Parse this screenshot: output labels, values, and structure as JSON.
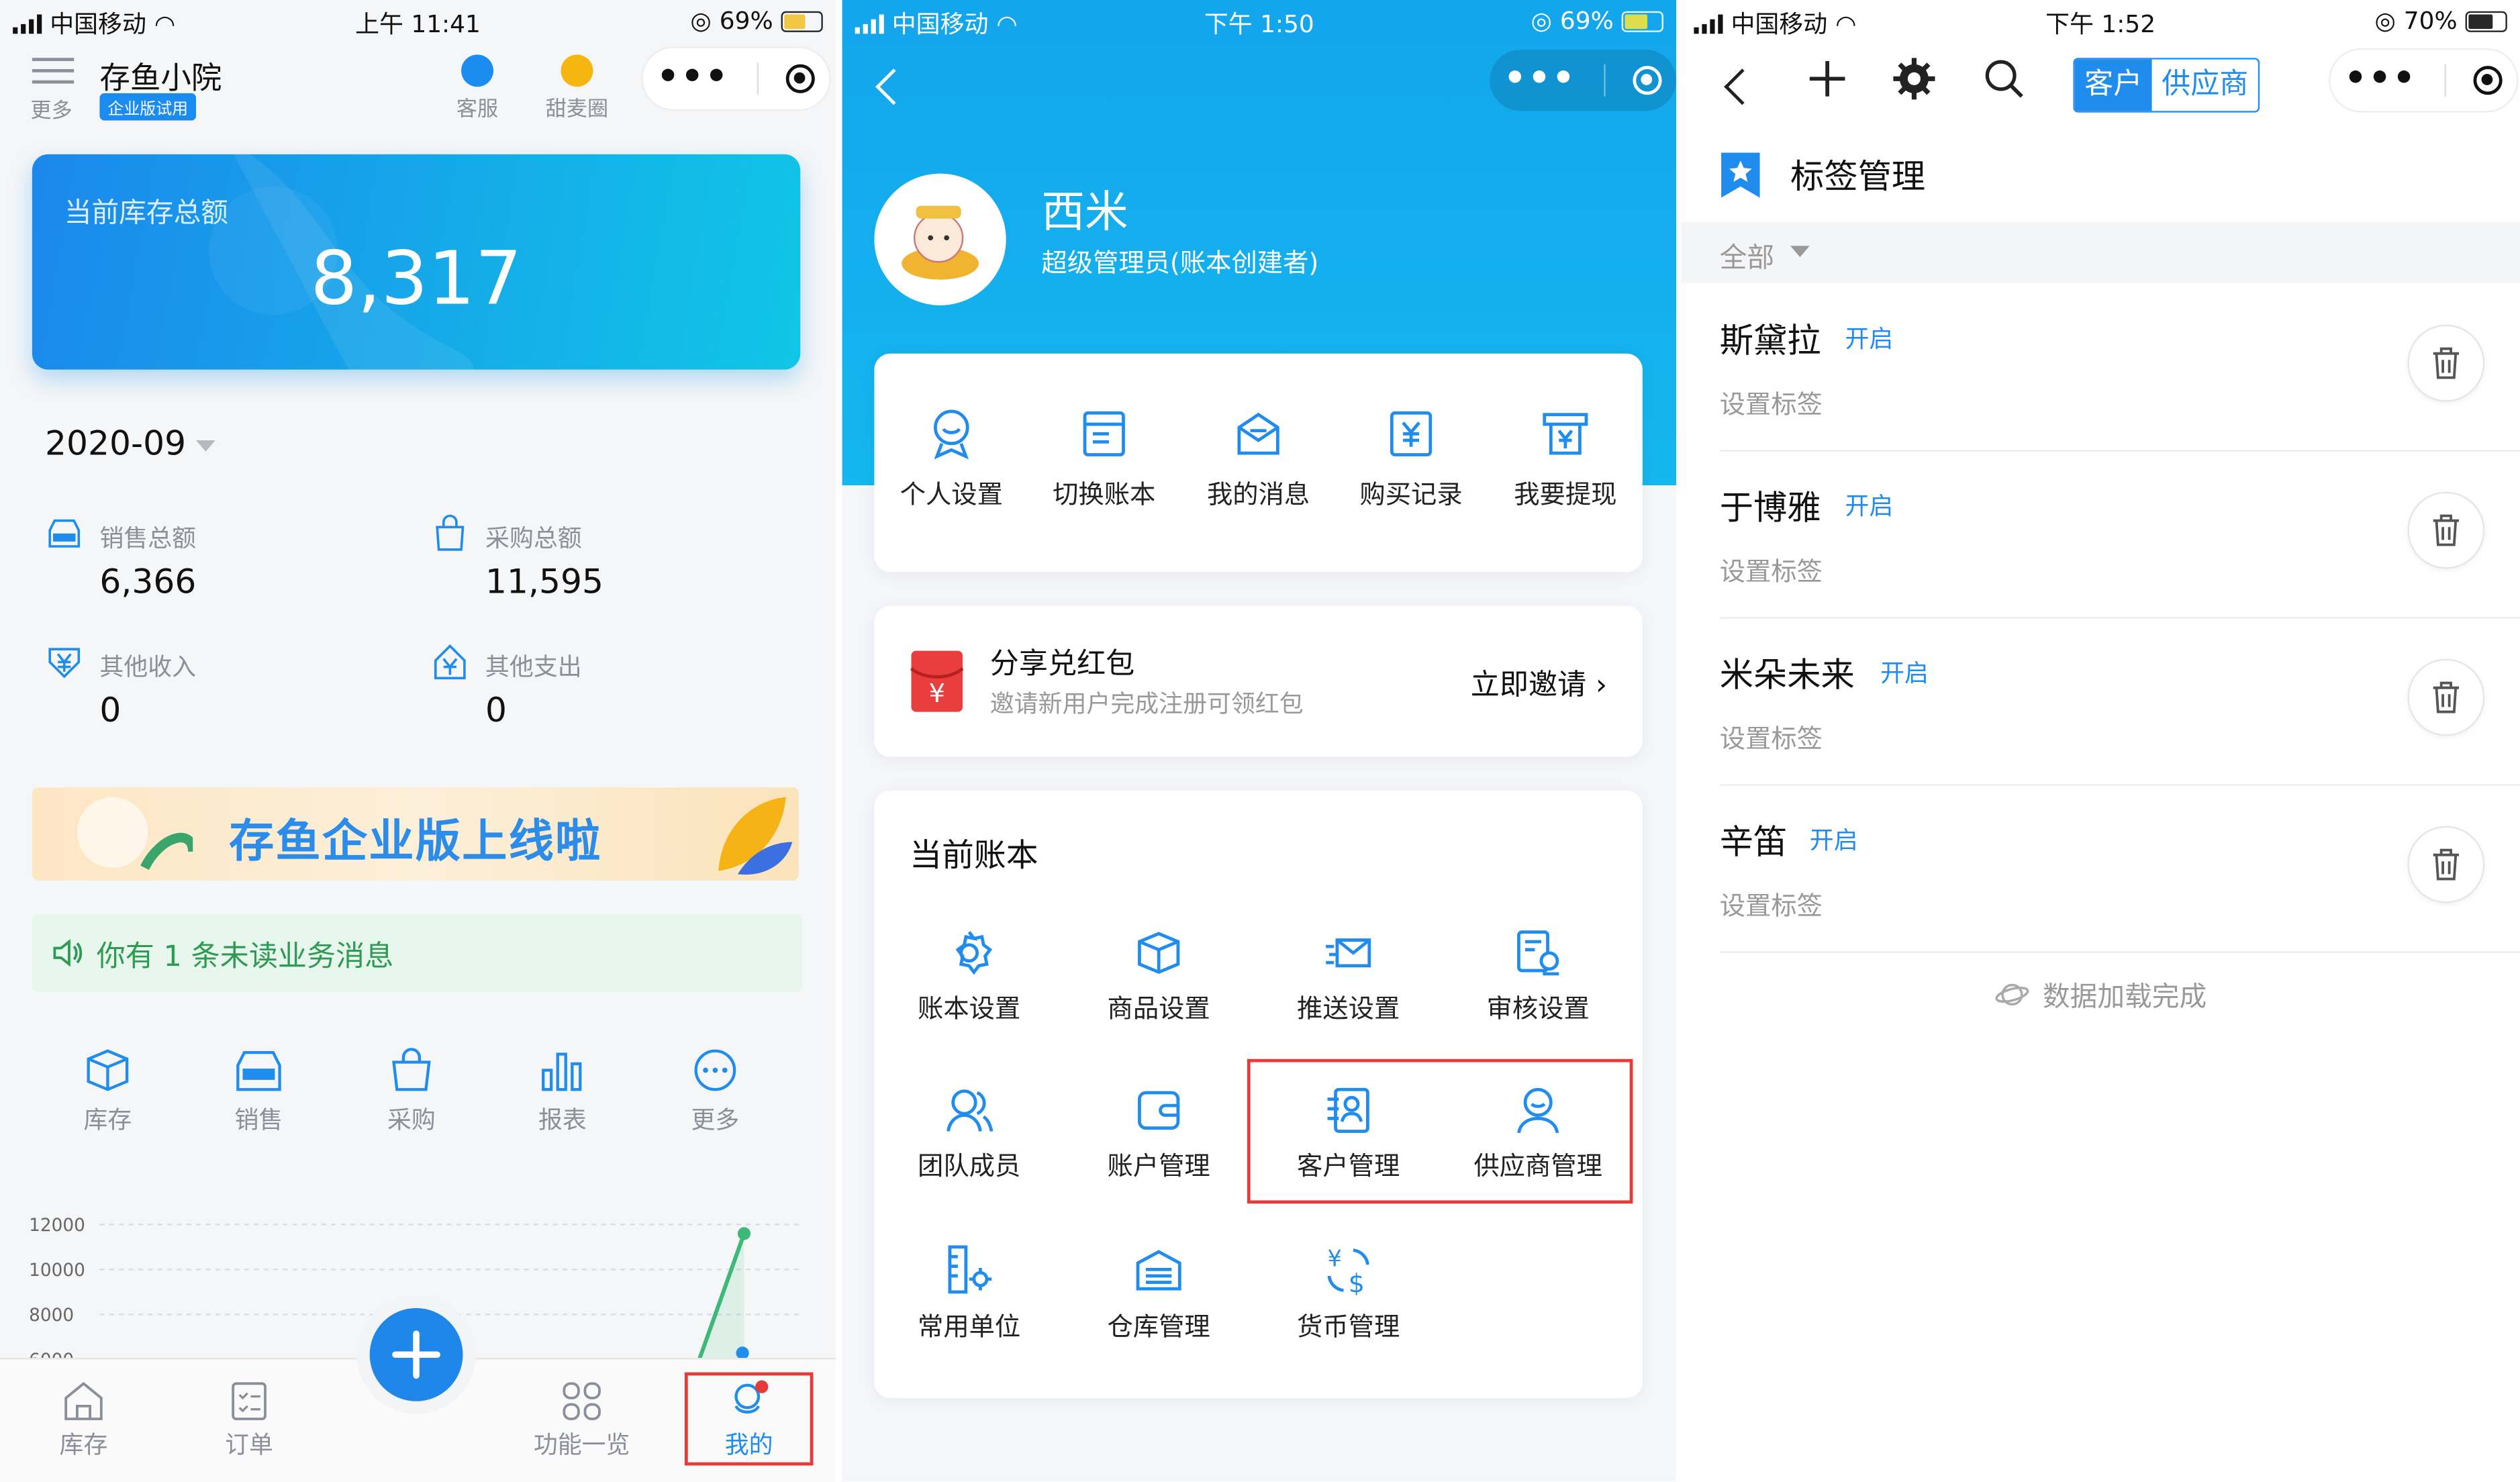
{
  "colors": {
    "primary": "#1f8cee",
    "header_blue": "#13a5ec",
    "success_green": "#2e9a52",
    "highlight_red": "#e53b3b"
  },
  "panel1": {
    "status": {
      "carrier": "中国移动",
      "time": "上午 11:41",
      "battery": "69%"
    },
    "header": {
      "menu_label": "更多",
      "shop_name": "存鱼小院",
      "badge": "企业版试用",
      "service_label": "客服",
      "community_label": "甜麦圈"
    },
    "stock": {
      "label": "当前库存总额",
      "value": "8,317"
    },
    "month": "2020-09",
    "stats": [
      {
        "label": "销售总额",
        "value": "6,366",
        "icon": "sale-icon"
      },
      {
        "label": "采购总额",
        "value": "11,595",
        "icon": "bag-icon"
      },
      {
        "label": "其他收入",
        "value": "0",
        "icon": "yen-in-icon"
      },
      {
        "label": "其他支出",
        "value": "0",
        "icon": "yen-out-icon"
      }
    ],
    "banner_text": "存鱼企业版上线啦",
    "notice_text": "你有 1 条未读业务消息",
    "quick_links": [
      "库存",
      "销售",
      "采购",
      "报表",
      "更多"
    ],
    "chart_data": {
      "type": "line",
      "y_ticks": [
        "12000",
        "10000",
        "8000",
        "6000"
      ],
      "ylim": [
        6000,
        12000
      ],
      "series": [
        {
          "values": [
            6000,
            11595
          ]
        }
      ]
    },
    "tabs": [
      "库存",
      "订单",
      "功能一览",
      "我的"
    ]
  },
  "panel2": {
    "status": {
      "carrier": "中国移动",
      "time": "下午 1:50",
      "battery": "69%"
    },
    "user": {
      "name": "西米",
      "role": "超级管理员(账本创建者)"
    },
    "top_actions": [
      "个人设置",
      "切换账本",
      "我的消息",
      "购买记录",
      "我要提现"
    ],
    "share": {
      "title": "分享兑红包",
      "subtitle": "邀请新用户完成注册可领红包",
      "action": "立即邀请"
    },
    "account": {
      "title": "当前账本",
      "items": [
        "账本设置",
        "商品设置",
        "推送设置",
        "审核设置",
        "团队成员",
        "账户管理",
        "客户管理",
        "供应商管理",
        "常用单位",
        "仓库管理",
        "货币管理"
      ]
    }
  },
  "panel3": {
    "status": {
      "carrier": "中国移动",
      "time": "下午 1:52",
      "battery": "70%"
    },
    "segment": {
      "customer": "客户",
      "supplier": "供应商"
    },
    "title": "标签管理",
    "filter": "全部",
    "contacts": [
      {
        "name": "斯黛拉",
        "status": "开启",
        "tag": "设置标签"
      },
      {
        "name": "于博雅",
        "status": "开启",
        "tag": "设置标签"
      },
      {
        "name": "米朵未来",
        "status": "开启",
        "tag": "设置标签"
      },
      {
        "name": "辛笛",
        "status": "开启",
        "tag": "设置标签"
      }
    ],
    "footer": "数据加载完成"
  }
}
